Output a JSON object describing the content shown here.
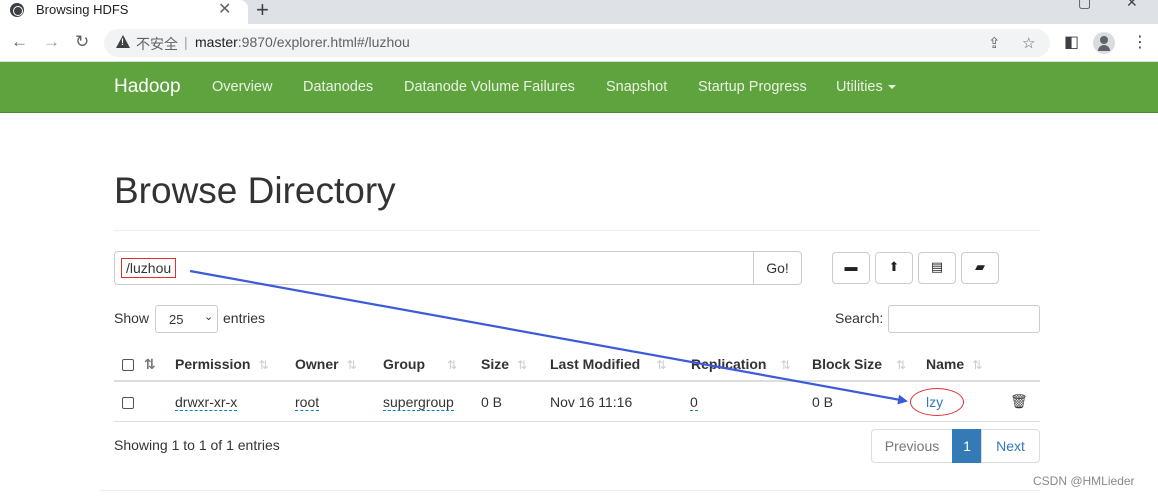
{
  "browser": {
    "tab_title": "Browsing HDFS",
    "security_label": "不安全",
    "url_host": "master",
    "url_rest": ":9870/explorer.html#/luzhou"
  },
  "navbar": {
    "brand": "Hadoop",
    "items": [
      "Overview",
      "Datanodes",
      "Datanode Volume Failures",
      "Snapshot",
      "Startup Progress",
      "Utilities"
    ]
  },
  "page": {
    "title": "Browse Directory",
    "path_value": "/luzhou",
    "go_label": "Go!"
  },
  "table_controls": {
    "show_label": "Show",
    "entries_value": "25",
    "entries_label": "entries",
    "search_label": "Search:"
  },
  "table": {
    "columns": [
      "Permission",
      "Owner",
      "Group",
      "Size",
      "Last Modified",
      "Replication",
      "Block Size",
      "Name"
    ],
    "rows": [
      {
        "permission": "drwxr-xr-x",
        "owner": "root",
        "group": "supergroup",
        "size": "0 B",
        "last_modified": "Nov 16 11:16",
        "replication": "0",
        "block_size": "0 B",
        "name": "lzy"
      }
    ]
  },
  "footer": {
    "showing": "Showing 1 to 1 of 1 entries",
    "prev_label": "Previous",
    "current_page": "1",
    "next_label": "Next"
  },
  "watermark": "CSDN @HMLieder",
  "colors": {
    "navbar": "#5fa33e",
    "annotation_red": "#e03030",
    "annotation_arrow": "#3b5bdb",
    "link": "#337ab7"
  }
}
